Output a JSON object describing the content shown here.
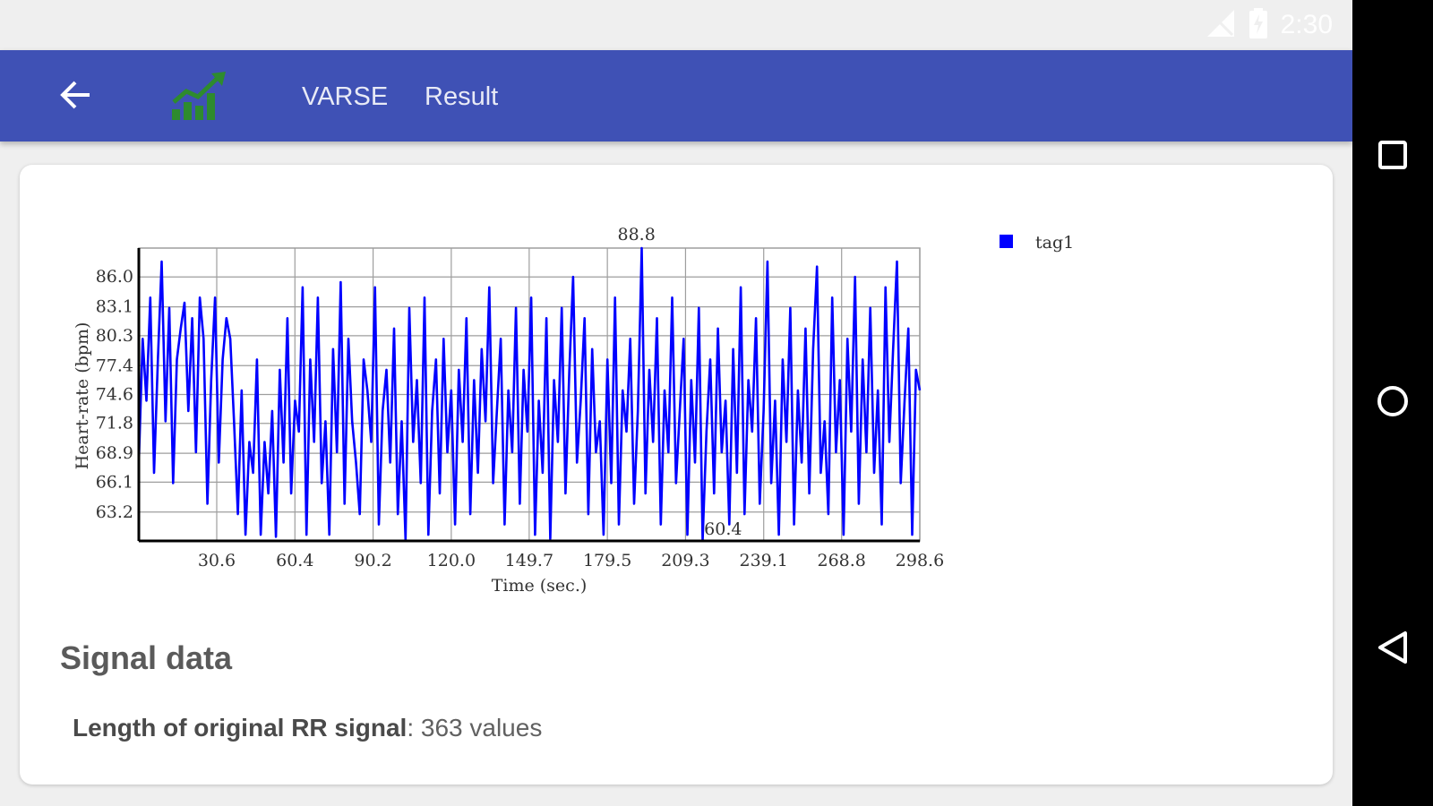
{
  "status": {
    "time": "2:30",
    "icons": [
      "signal-icon",
      "battery-icon"
    ]
  },
  "appbar": {
    "app_name": "VARSE",
    "screen_title": "Result",
    "back_icon": "arrow-left-icon",
    "logo_icon": "chart-logo-icon",
    "color": "#3f51b5",
    "logo_color": "#2e8b2e"
  },
  "navigation": {
    "recents_icon": "square-icon",
    "home_icon": "circle-icon",
    "back_icon": "triangle-back-icon"
  },
  "chart_data": {
    "type": "line",
    "title": "",
    "xlabel": "Time (sec.)",
    "ylabel": "Heart-rate (bpm)",
    "xticks": [
      "30.6",
      "60.4",
      "90.2",
      "120.0",
      "149.7",
      "179.5",
      "209.3",
      "239.1",
      "268.8",
      "298.6"
    ],
    "yticks": [
      "63.2",
      "66.1",
      "68.9",
      "71.8",
      "74.6",
      "77.4",
      "80.3",
      "83.1",
      "86.0"
    ],
    "xlim": [
      0.9,
      298.6
    ],
    "ylim": [
      60.4,
      88.8
    ],
    "max_label": "88.8",
    "min_label": "60.4",
    "max_x": 190.6,
    "min_x": 223.6,
    "grid": true,
    "legend_position": "top-right",
    "series": [
      {
        "name": "tag1",
        "color": "#0000ff",
        "x_start": 0.9,
        "x_end": 298.6,
        "values": [
          68.0,
          80.0,
          74.0,
          84.0,
          67.0,
          78.0,
          87.5,
          72.0,
          83.0,
          66.0,
          78.0,
          81.0,
          83.5,
          73.0,
          82.0,
          69.0,
          84.0,
          80.0,
          64.0,
          76.0,
          84.0,
          68.0,
          78.0,
          82.0,
          80.0,
          72.0,
          63.0,
          75.0,
          61.0,
          70.0,
          67.0,
          78.0,
          61.0,
          70.0,
          65.0,
          73.0,
          60.8,
          77.0,
          68.0,
          82.0,
          65.0,
          74.0,
          71.0,
          85.0,
          61.0,
          78.0,
          70.0,
          84.0,
          66.0,
          72.0,
          61.0,
          79.0,
          69.0,
          85.5,
          64.0,
          80.0,
          72.0,
          68.0,
          63.0,
          78.0,
          75.0,
          70.0,
          85.0,
          62.0,
          73.0,
          77.0,
          68.0,
          81.0,
          63.0,
          72.0,
          60.5,
          83.0,
          70.0,
          76.0,
          66.0,
          84.0,
          61.0,
          73.0,
          78.0,
          65.0,
          80.0,
          69.0,
          75.0,
          62.0,
          77.0,
          70.0,
          82.0,
          63.0,
          76.0,
          67.0,
          79.0,
          72.0,
          85.0,
          66.0,
          73.0,
          80.0,
          62.0,
          75.0,
          69.0,
          83.0,
          64.0,
          77.0,
          71.0,
          84.0,
          61.0,
          74.0,
          67.0,
          82.0,
          60.6,
          76.0,
          70.0,
          83.0,
          65.0,
          77.0,
          86.0,
          68.0,
          74.0,
          82.0,
          63.0,
          79.0,
          69.0,
          72.0,
          61.0,
          78.0,
          66.0,
          84.0,
          62.0,
          75.0,
          71.0,
          80.0,
          64.0,
          73.0,
          88.8,
          65.0,
          77.0,
          70.0,
          82.0,
          62.0,
          75.0,
          69.0,
          84.0,
          66.0,
          73.0,
          80.0,
          61.0,
          76.0,
          68.0,
          83.0,
          60.4,
          71.0,
          78.0,
          65.0,
          81.0,
          69.0,
          74.0,
          62.0,
          79.0,
          67.0,
          85.0,
          63.0,
          76.0,
          71.0,
          82.0,
          64.0,
          73.0,
          87.5,
          66.0,
          74.0,
          61.0,
          78.0,
          70.0,
          83.0,
          62.0,
          75.0,
          68.0,
          81.0,
          65.0,
          79.0,
          87.0,
          67.0,
          72.0,
          63.0,
          84.0,
          69.0,
          76.0,
          61.0,
          80.0,
          71.0,
          86.0,
          64.0,
          78.0,
          69.0,
          83.0,
          67.0,
          75.0,
          62.0,
          85.0,
          70.0,
          79.0,
          87.5,
          66.0,
          74.0,
          81.0,
          61.0,
          77.0,
          75.0
        ]
      }
    ]
  },
  "signal": {
    "title": "Signal data",
    "length_label": "Length of original RR signal",
    "length_value": ": 363 values"
  }
}
